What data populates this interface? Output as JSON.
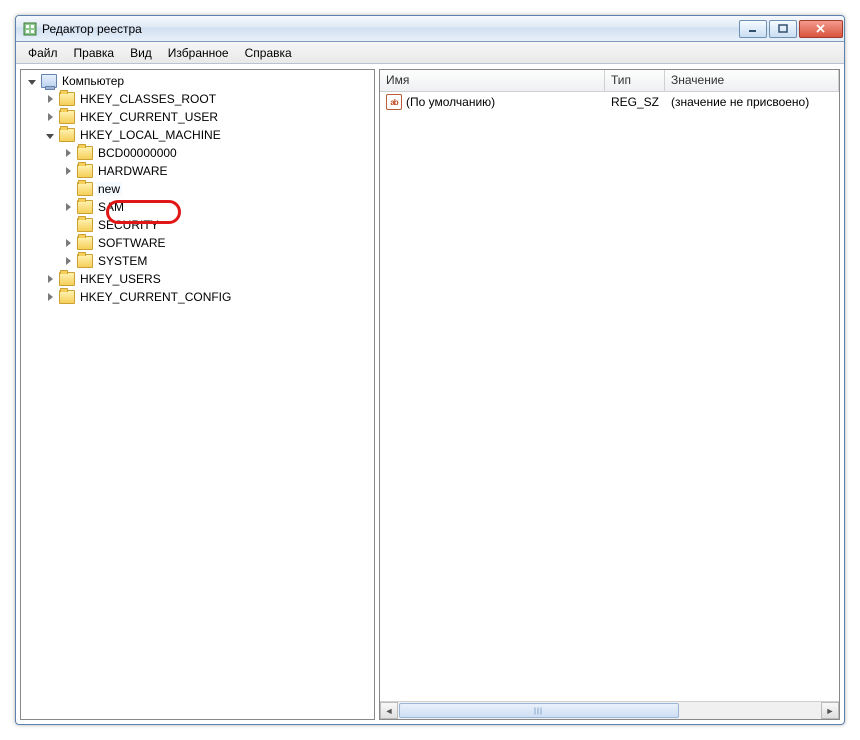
{
  "window": {
    "title": "Редактор реестра"
  },
  "menus": [
    "Файл",
    "Правка",
    "Вид",
    "Избранное",
    "Справка"
  ],
  "tree": {
    "root": "Компьютер",
    "hives": [
      {
        "name": "HKEY_CLASSES_ROOT",
        "expandable": true
      },
      {
        "name": "HKEY_CURRENT_USER",
        "expandable": true
      },
      {
        "name": "HKEY_LOCAL_MACHINE",
        "expandable": true,
        "expanded": true,
        "children": [
          {
            "name": "BCD00000000",
            "expandable": true
          },
          {
            "name": "HARDWARE",
            "expandable": true
          },
          {
            "name": "new",
            "expandable": false,
            "highlighted": true
          },
          {
            "name": "SAM",
            "expandable": true
          },
          {
            "name": "SECURITY",
            "expandable": false
          },
          {
            "name": "SOFTWARE",
            "expandable": true
          },
          {
            "name": "SYSTEM",
            "expandable": true
          }
        ]
      },
      {
        "name": "HKEY_USERS",
        "expandable": true
      },
      {
        "name": "HKEY_CURRENT_CONFIG",
        "expandable": true
      }
    ]
  },
  "list": {
    "columns": {
      "name": "Имя",
      "type": "Тип",
      "value": "Значение"
    },
    "rows": [
      {
        "icon": "ab",
        "name": "(По умолчанию)",
        "type": "REG_SZ",
        "value": "(значение не присвоено)"
      }
    ]
  }
}
